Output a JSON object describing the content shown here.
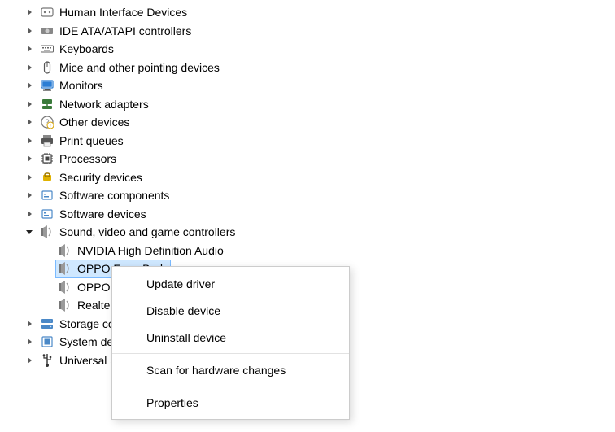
{
  "device_tree": {
    "items": [
      {
        "label": "Human Interface Devices",
        "icon": "hid-icon",
        "expanded": false,
        "level": 0
      },
      {
        "label": "IDE ATA/ATAPI controllers",
        "icon": "ide-icon",
        "expanded": false,
        "level": 0
      },
      {
        "label": "Keyboards",
        "icon": "keyboard-icon",
        "expanded": false,
        "level": 0
      },
      {
        "label": "Mice and other pointing devices",
        "icon": "mouse-icon",
        "expanded": false,
        "level": 0
      },
      {
        "label": "Monitors",
        "icon": "monitor-icon",
        "expanded": false,
        "level": 0
      },
      {
        "label": "Network adapters",
        "icon": "network-icon",
        "expanded": false,
        "level": 0
      },
      {
        "label": "Other devices",
        "icon": "other-icon",
        "expanded": false,
        "level": 0
      },
      {
        "label": "Print queues",
        "icon": "printer-icon",
        "expanded": false,
        "level": 0
      },
      {
        "label": "Processors",
        "icon": "cpu-icon",
        "expanded": false,
        "level": 0
      },
      {
        "label": "Security devices",
        "icon": "security-icon",
        "expanded": false,
        "level": 0
      },
      {
        "label": "Software components",
        "icon": "software-comp-icon",
        "expanded": false,
        "level": 0
      },
      {
        "label": "Software devices",
        "icon": "software-dev-icon",
        "expanded": false,
        "level": 0
      },
      {
        "label": "Sound, video and game controllers",
        "icon": "sound-icon",
        "expanded": true,
        "level": 0
      },
      {
        "label": "NVIDIA High Definition Audio",
        "icon": "speaker-icon",
        "expanded": null,
        "level": 1
      },
      {
        "label": "OPPO Enco Buds",
        "icon": "speaker-icon",
        "expanded": null,
        "level": 1,
        "selected": true
      },
      {
        "label": "OPPO Enco Buds",
        "icon": "speaker-icon",
        "expanded": null,
        "level": 1
      },
      {
        "label": "Realtek(R) Audio",
        "icon": "speaker-icon",
        "expanded": null,
        "level": 1
      },
      {
        "label": "Storage controllers",
        "icon": "storage-icon",
        "expanded": false,
        "level": 0
      },
      {
        "label": "System devices",
        "icon": "system-icon",
        "expanded": false,
        "level": 0
      },
      {
        "label": "Universal Serial Bus controllers",
        "icon": "usb-icon",
        "expanded": false,
        "level": 0
      }
    ]
  },
  "context_menu": {
    "groups": [
      [
        "Update driver",
        "Disable device",
        "Uninstall device"
      ],
      [
        "Scan for hardware changes"
      ],
      [
        "Properties"
      ]
    ]
  }
}
